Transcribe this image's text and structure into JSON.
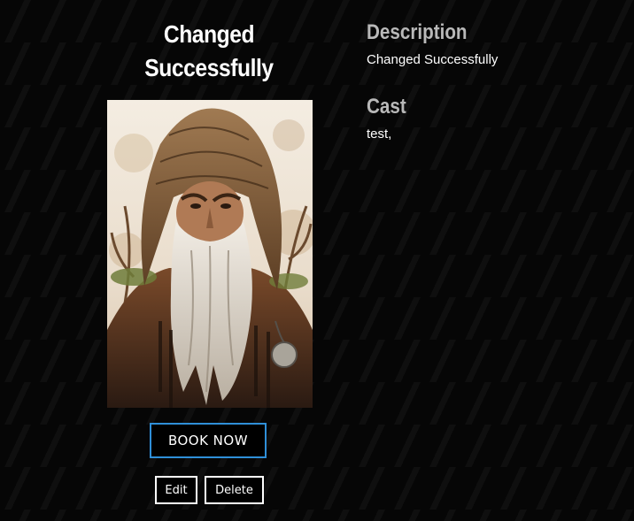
{
  "movie": {
    "title": "Changed Successfully",
    "poster_subject": "hooded old wizard with long white beard (watercolor illustration)"
  },
  "actions": {
    "book_label": "BOOK NOW",
    "edit_label": "Edit",
    "delete_label": "Delete"
  },
  "details": {
    "description_heading": "Description",
    "description_text": "Changed Successfully",
    "cast_heading": "Cast",
    "cast_text": "test,"
  },
  "colors": {
    "background": "#050505",
    "book_border": "#2f8fd8",
    "heading": "#b9b9b9",
    "text": "#ffffff"
  }
}
